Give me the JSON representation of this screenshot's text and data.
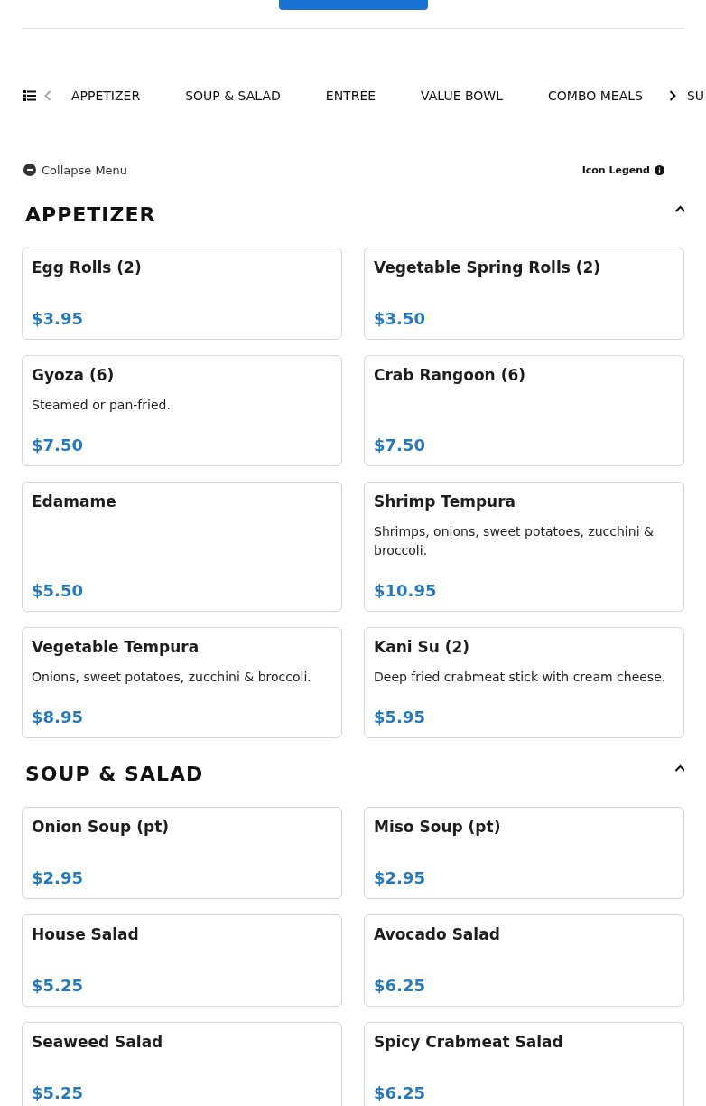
{
  "nav": {
    "scroll_left": {
      "disabled": true
    },
    "scroll_right": {
      "disabled": false
    },
    "tabs": [
      {
        "label": "APPETIZER",
        "selected": false
      },
      {
        "label": "SOUP & SALAD",
        "selected": false
      },
      {
        "label": "ENTRÉE",
        "selected": false
      },
      {
        "label": "VALUE BOWL",
        "selected": false
      },
      {
        "label": "COMBO MEALS",
        "selected": false
      }
    ],
    "cut_tab": "SU"
  },
  "collapse_menu": "Collapse Menu",
  "icon_legend": "Icon Legend",
  "sections": [
    {
      "title": "APPETIZER",
      "expanded": true,
      "items": [
        {
          "name": "Egg Rolls (2)",
          "price": "$3.95"
        },
        {
          "name": "Vegetable Spring Rolls (2)",
          "price": "$3.50"
        },
        {
          "name": "Gyoza (6)",
          "description": "Steamed or pan-fried.",
          "price": "$7.50"
        },
        {
          "name": "Crab Rangoon (6)",
          "price": "$7.50"
        },
        {
          "name": "Edamame",
          "price": "$5.50"
        },
        {
          "name": "Shrimp Tempura",
          "description": "Shrimps, onions, sweet potatoes, zucchini & broccoli.",
          "price": "$10.95"
        },
        {
          "name": "Vegetable Tempura",
          "description": "Onions, sweet potatoes, zucchini & broccoli.",
          "price": "$8.95"
        },
        {
          "name": "Kani Su (2)",
          "description": "Deep fried crabmeat stick with cream cheese.",
          "price": "$5.95"
        }
      ]
    },
    {
      "title": "SOUP & SALAD",
      "expanded": true,
      "items": [
        {
          "name": "Onion Soup (pt)",
          "price": "$2.95"
        },
        {
          "name": "Miso Soup (pt)",
          "price": "$2.95"
        },
        {
          "name": "House Salad",
          "price": "$5.25"
        },
        {
          "name": "Avocado Salad",
          "price": "$6.25"
        },
        {
          "name": "Seaweed Salad",
          "price": "$5.25"
        },
        {
          "name": "Spicy Crabmeat Salad",
          "price": "$6.25"
        }
      ]
    }
  ]
}
